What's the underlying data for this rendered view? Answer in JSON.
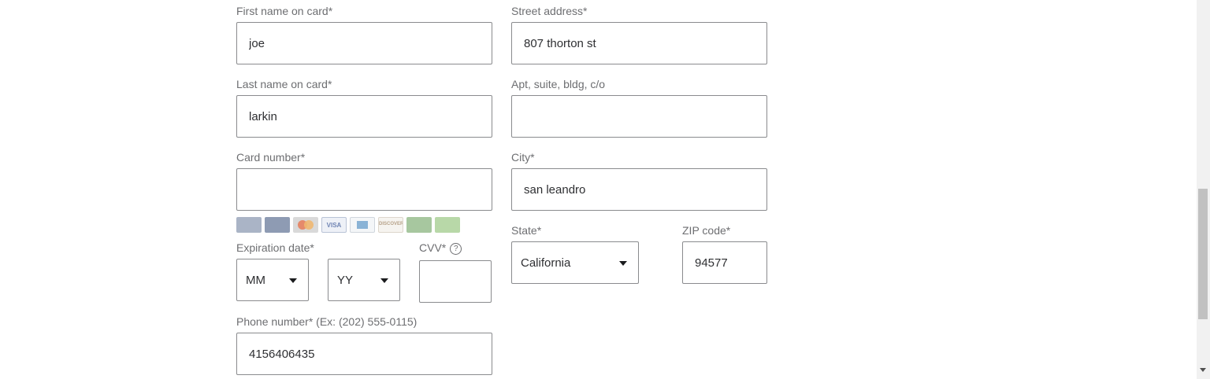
{
  "form": {
    "first_name": {
      "label": "First name on card*",
      "value": "joe"
    },
    "last_name": {
      "label": "Last name on card*",
      "value": "larkin"
    },
    "card_number": {
      "label": "Card number*",
      "value": ""
    },
    "card_brands": [
      "walmart-card",
      "capital-one-card",
      "mastercard",
      "visa",
      "amex",
      "discover",
      "card-7",
      "card-8"
    ],
    "expiration": {
      "label": "Expiration date*",
      "month": "MM",
      "year": "YY"
    },
    "cvv": {
      "label": "CVV*",
      "help": "?",
      "value": ""
    },
    "phone": {
      "label": "Phone number* (Ex: (202) 555-0115)",
      "value": "4156406435"
    },
    "street": {
      "label": "Street address*",
      "value": "807 thorton st"
    },
    "apt": {
      "label": "Apt, suite, bldg, c/o",
      "value": ""
    },
    "city": {
      "label": "City*",
      "value": "san leandro"
    },
    "state": {
      "label": "State*",
      "value": "California"
    },
    "zip": {
      "label": "ZIP code*",
      "value": "94577"
    }
  },
  "colors": {
    "border": "#8a8b8e",
    "label": "#6d6e71",
    "text": "#2e2f32"
  }
}
